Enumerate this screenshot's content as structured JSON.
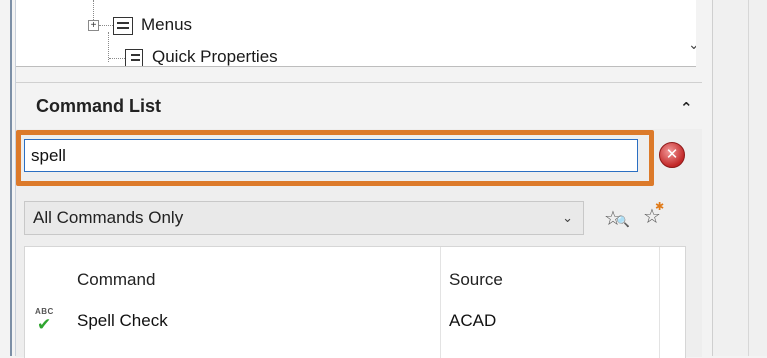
{
  "tree": {
    "items": [
      {
        "label": "Menus",
        "icon": "menu-icon"
      },
      {
        "label": "Quick Properties",
        "icon": "quick-properties-icon"
      }
    ],
    "expander": "+"
  },
  "command_list": {
    "title": "Command List",
    "collapse_icon": "double-chevron-up-icon",
    "search": {
      "value": "spell",
      "placeholder": ""
    },
    "clear_icon": "clear-search-icon",
    "filter": {
      "selected": "All Commands Only"
    },
    "columns": [
      "Command",
      "Source"
    ],
    "rows": [
      {
        "icon": "spell-check-icon",
        "command": "Spell Check",
        "source": "ACAD"
      }
    ]
  },
  "colors": {
    "highlight": "#dc7a2a",
    "input_border": "#2b6fc2",
    "clear_button": "#c22828",
    "check": "#2fa52f"
  }
}
